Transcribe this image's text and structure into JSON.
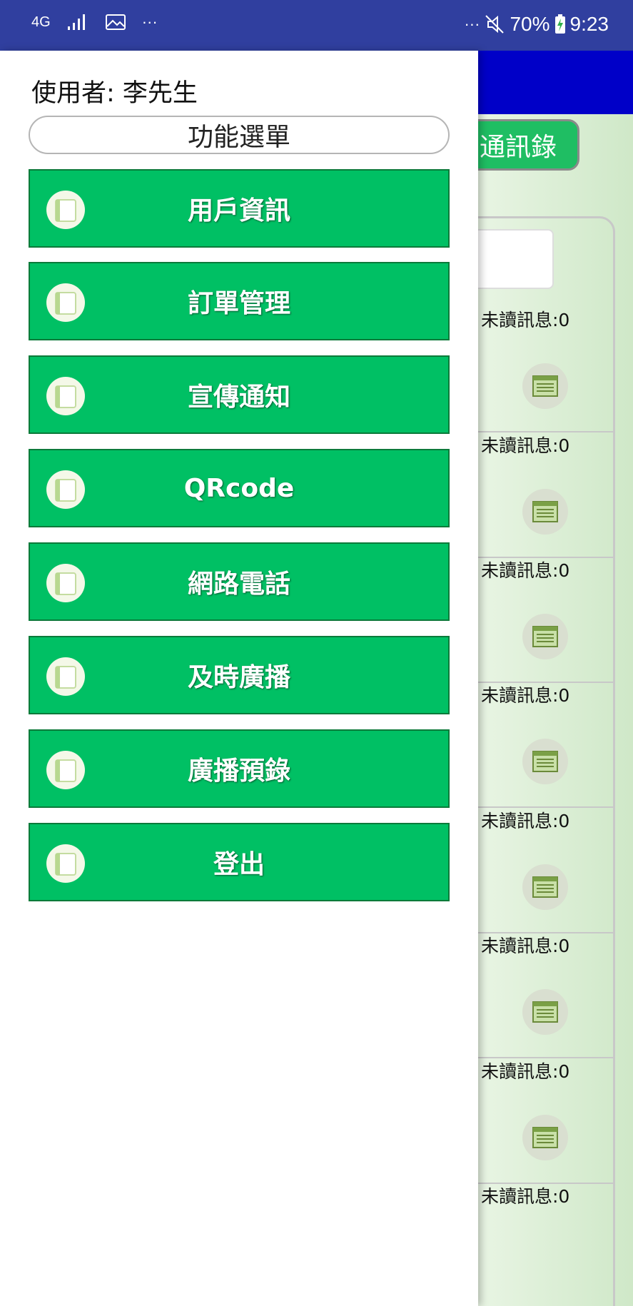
{
  "status_bar": {
    "network": "4G",
    "signal_icon": "signal-icon",
    "gallery_icon": "image-icon",
    "left_more": "···",
    "right_more": "···",
    "mute_icon": "mute-icon",
    "battery_percent": "70%",
    "battery_icon": "battery-charging-icon",
    "time": "9:23"
  },
  "background_app": {
    "contacts_button": "通訊錄",
    "unread_items": [
      "未讀訊息:0",
      "未讀訊息:0",
      "未讀訊息:0",
      "未讀訊息:0",
      "未讀訊息:0",
      "未讀訊息:0",
      "未讀訊息:0",
      "未讀訊息:0"
    ],
    "row_icon": "document-list-icon"
  },
  "drawer": {
    "user_label": "使用者: 李先生",
    "menu_title": "功能選單",
    "items": [
      {
        "label": "用戶資訊",
        "icon": "folder-icon"
      },
      {
        "label": "訂單管理",
        "icon": "folder-icon"
      },
      {
        "label": "宣傳通知",
        "icon": "folder-icon"
      },
      {
        "label": "QRcode",
        "icon": "folder-icon"
      },
      {
        "label": "網路電話",
        "icon": "folder-icon"
      },
      {
        "label": "及時廣播",
        "icon": "folder-icon"
      },
      {
        "label": "廣播預錄",
        "icon": "folder-icon"
      },
      {
        "label": "登出",
        "icon": "folder-icon"
      }
    ]
  },
  "colors": {
    "status_bar": "#303f9f",
    "app_header": "#0000c8",
    "menu_button": "#00c064",
    "menu_button_border": "#0b7a3a"
  }
}
